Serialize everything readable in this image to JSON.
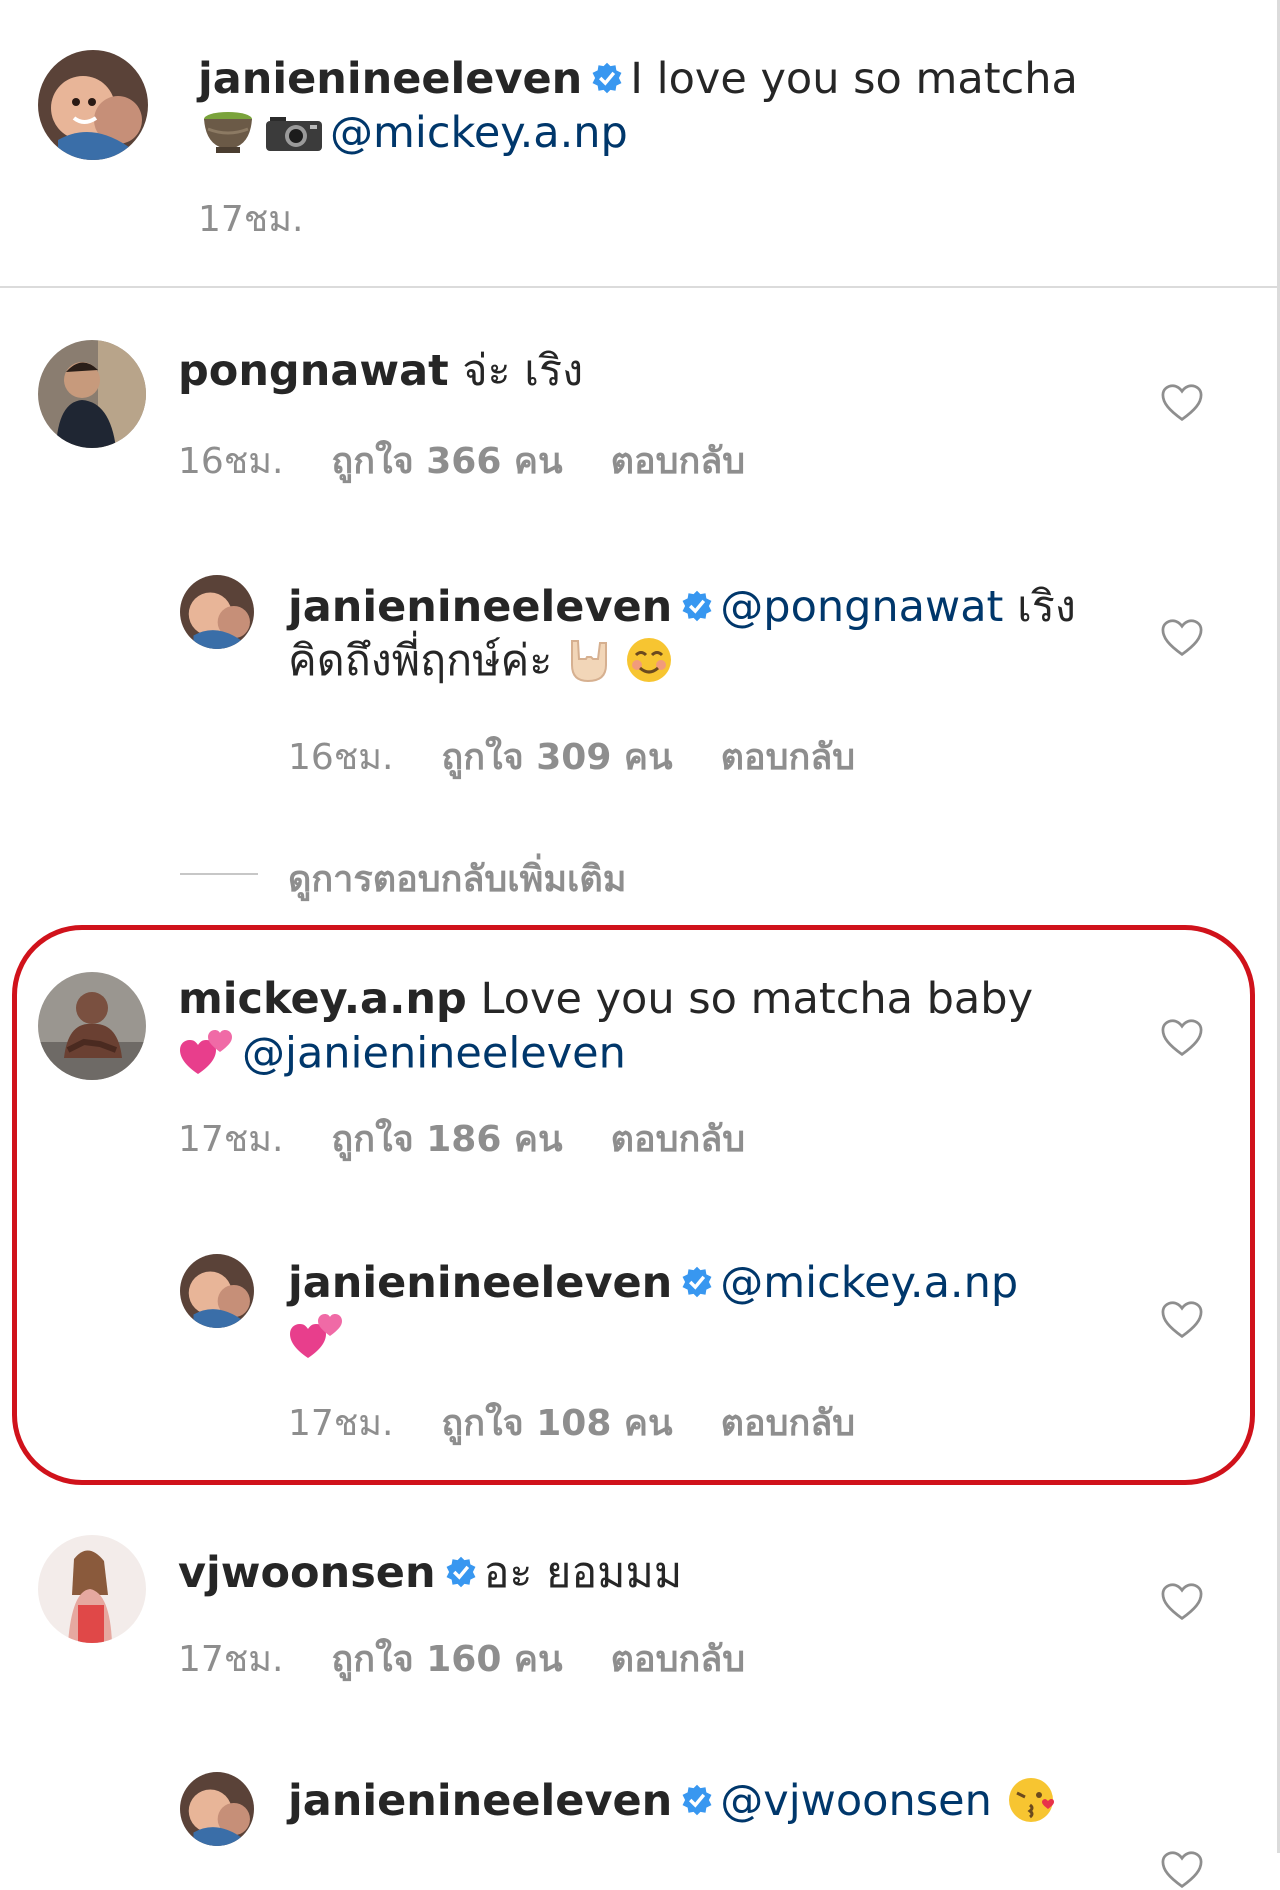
{
  "caption": {
    "username": "janienineeleven",
    "text": "I love you so matcha",
    "mention": "@mickey.a.np",
    "emojis": [
      "matcha-tea-icon",
      "camera-icon"
    ],
    "time": "17ชม."
  },
  "comments": [
    {
      "username": "pongnawat",
      "text": "จ่ะ เริง",
      "time": "16ชม.",
      "likes": "ถูกใจ 366 คน",
      "reply_label": "ตอบกลับ",
      "reply": {
        "username": "janienineeleven",
        "mention": "@pongnawat",
        "text_line1": "เริง",
        "text_line2": "คิดถึงพี่ฤกษ์ค่ะ",
        "emojis": [
          "rock-hand-icon",
          "smiling-face-icon"
        ],
        "time": "16ชม.",
        "likes": "ถูกใจ 309 คน",
        "reply_label": "ตอบกลับ"
      },
      "more_replies": "ดูการตอบกลับเพิ่มเติม"
    },
    {
      "username": "mickey.a.np",
      "text": "Love you so matcha baby",
      "mention": "@janienineeleven",
      "emojis": [
        "two-hearts-icon"
      ],
      "time": "17ชม.",
      "likes": "ถูกใจ 186 คน",
      "reply_label": "ตอบกลับ",
      "highlighted": true,
      "reply": {
        "username": "janienineeleven",
        "mention": "@mickey.a.np",
        "emojis": [
          "two-hearts-icon"
        ],
        "time": "17ชม.",
        "likes": "ถูกใจ 108 คน",
        "reply_label": "ตอบกลับ"
      }
    },
    {
      "username": "vjwoonsen",
      "text": "อะ ยอมมม",
      "time": "17ชม.",
      "likes": "ถูกใจ 160 คน",
      "reply_label": "ตอบกลับ",
      "reply": {
        "username": "janienineeleven",
        "mention": "@vjwoonsen",
        "emojis": [
          "kissing-face-icon"
        ]
      }
    }
  ],
  "colors": {
    "text": "#262626",
    "mention": "#00376b",
    "meta": "#8e8e8e",
    "verified": "#3897f0",
    "highlight_border": "#d0121b"
  }
}
